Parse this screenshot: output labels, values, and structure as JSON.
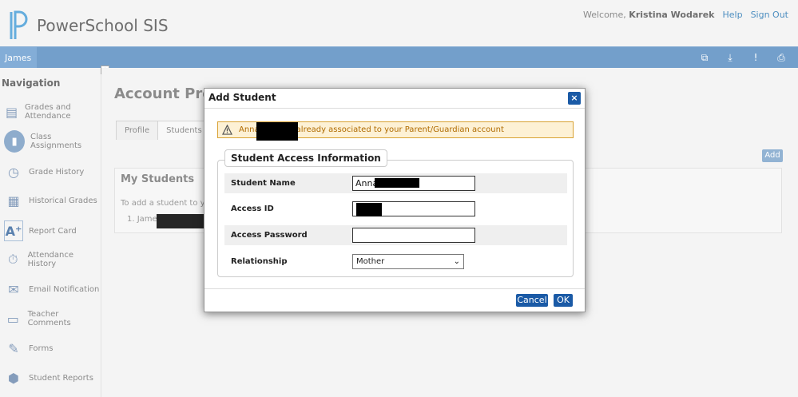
{
  "app": {
    "title": "PowerSchool SIS"
  },
  "header": {
    "welcome_prefix": "Welcome,",
    "user_name": "Kristina Wodarek",
    "help": "Help",
    "sign_out": "Sign Out"
  },
  "student_tab": "James",
  "nav": {
    "title": "Navigation",
    "items": [
      {
        "label": "Grades and Attendance",
        "icon": "grades-icon"
      },
      {
        "label": "Class Assignments",
        "icon": "chart-icon"
      },
      {
        "label": "Grade History",
        "icon": "history-icon"
      },
      {
        "label": "Historical Grades",
        "icon": "calendar-icon"
      },
      {
        "label": "Report Card",
        "icon": "report-card-icon"
      },
      {
        "label": "Attendance History",
        "icon": "attendance-icon"
      },
      {
        "label": "Email Notification",
        "icon": "email-icon"
      },
      {
        "label": "Teacher Comments",
        "icon": "comment-icon"
      },
      {
        "label": "Forms",
        "icon": "forms-icon"
      },
      {
        "label": "Student Reports",
        "icon": "reports-icon"
      }
    ]
  },
  "main": {
    "page_title": "Account Pre",
    "tabs": [
      "Profile",
      "Students"
    ],
    "add_label": "Add",
    "card": {
      "title": "My Students",
      "text": "To add a student to you",
      "list_item": "1. Jame"
    }
  },
  "dialog": {
    "title": "Add Student",
    "close_label": "×",
    "warning_prefix": "Anna",
    "warning_suffix": "already associated to your Parent/Guardian account",
    "section_title": "Student Access Information",
    "fields": {
      "student_name_label": "Student Name",
      "student_name_value": "Anna",
      "access_id_label": "Access ID",
      "access_password_label": "Access Password",
      "relationship_label": "Relationship",
      "relationship_value": "Mother"
    },
    "cancel": "Cancel",
    "ok": "OK"
  },
  "colors": {
    "bar_blue": "#5b8fc2",
    "dialog_button": "#1a5aa6",
    "warning_bg": "#fdf1d5",
    "warning_border": "#d9a233"
  }
}
